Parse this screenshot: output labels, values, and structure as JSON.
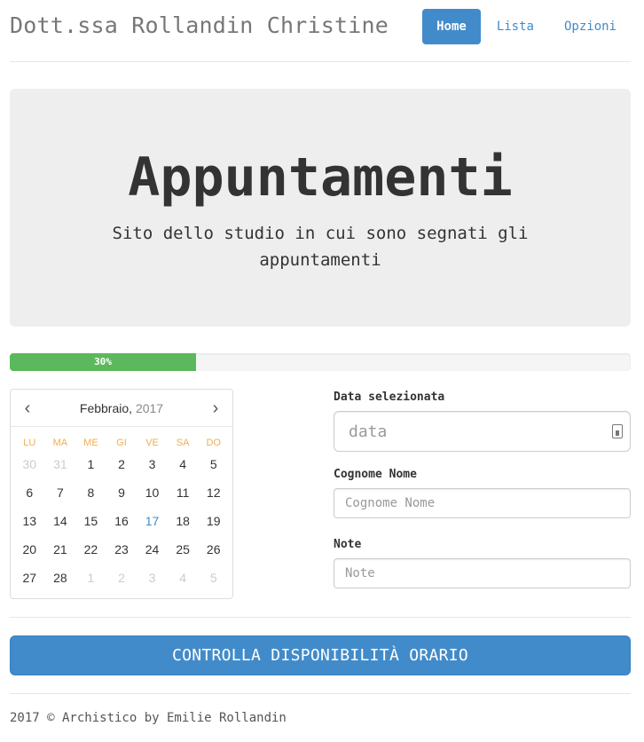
{
  "header": {
    "brand": "Dott.ssa Rollandin Christine",
    "nav": [
      {
        "label": "Home",
        "active": true
      },
      {
        "label": "Lista",
        "active": false
      },
      {
        "label": "Opzioni",
        "active": false
      }
    ]
  },
  "jumbotron": {
    "title": "Appuntamenti",
    "subtitle": "Sito dello studio in cui sono segnati gli appuntamenti"
  },
  "progress": {
    "value": 0.3,
    "label": "30%",
    "color": "#5cb85c"
  },
  "calendar": {
    "month": "Febbraio,",
    "year": "2017",
    "prev_icon": "chevron-left-icon",
    "next_icon": "chevron-right-icon",
    "weekdays": [
      "LU",
      "MA",
      "ME",
      "GI",
      "VE",
      "SA",
      "DO"
    ],
    "days": [
      {
        "n": "30",
        "muted": true
      },
      {
        "n": "31",
        "muted": true
      },
      {
        "n": "1"
      },
      {
        "n": "2"
      },
      {
        "n": "3"
      },
      {
        "n": "4"
      },
      {
        "n": "5"
      },
      {
        "n": "6"
      },
      {
        "n": "7"
      },
      {
        "n": "8"
      },
      {
        "n": "9"
      },
      {
        "n": "10"
      },
      {
        "n": "11"
      },
      {
        "n": "12"
      },
      {
        "n": "13"
      },
      {
        "n": "14"
      },
      {
        "n": "15"
      },
      {
        "n": "16"
      },
      {
        "n": "17",
        "today": true
      },
      {
        "n": "18"
      },
      {
        "n": "19"
      },
      {
        "n": "20"
      },
      {
        "n": "21"
      },
      {
        "n": "22"
      },
      {
        "n": "23"
      },
      {
        "n": "24"
      },
      {
        "n": "25"
      },
      {
        "n": "26"
      },
      {
        "n": "27"
      },
      {
        "n": "28"
      },
      {
        "n": "1",
        "muted": true
      },
      {
        "n": "2",
        "muted": true
      },
      {
        "n": "3",
        "muted": true
      },
      {
        "n": "4",
        "muted": true
      },
      {
        "n": "5",
        "muted": true
      }
    ]
  },
  "form": {
    "date_label": "Data selezionata",
    "date_placeholder": "data",
    "date_icon": "calendar-icon",
    "name_label": "Cognome Nome",
    "name_placeholder": "Cognome Nome",
    "notes_label": "Note",
    "notes_placeholder": "Note"
  },
  "cta": {
    "label": "CONTROLLA DISPONIBILITÀ ORARIO"
  },
  "footer": {
    "text": "2017 © Archistico by Emilie Rollandin"
  },
  "colors": {
    "primary": "#428bca",
    "success": "#5cb85c",
    "weekday": "#f0ad4e"
  }
}
